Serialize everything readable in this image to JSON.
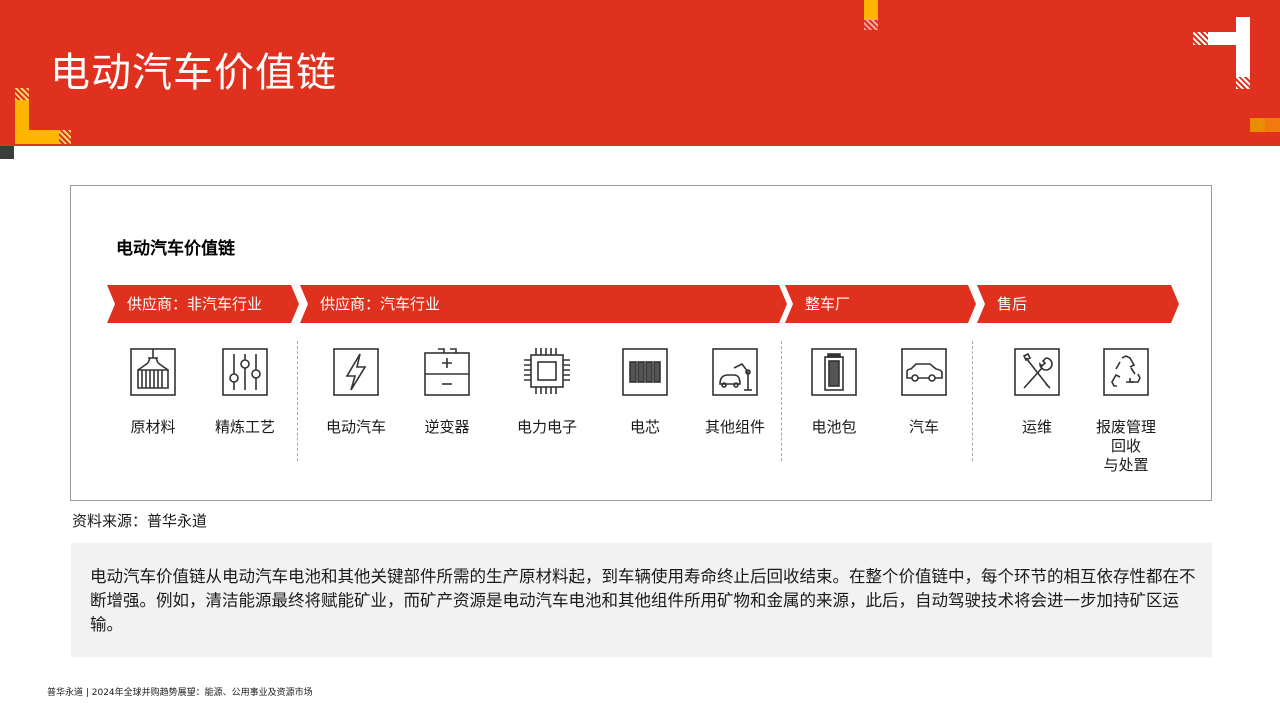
{
  "header": {
    "title": "电动汽车价值链"
  },
  "chart": {
    "title": "电动汽车价值链",
    "stages": [
      {
        "label": "供应商：非汽车行业"
      },
      {
        "label": "供应商：汽车行业"
      },
      {
        "label": "整车厂"
      },
      {
        "label": "售后"
      }
    ],
    "items": [
      {
        "label": "原材料",
        "icon": "raw-material-crane-icon"
      },
      {
        "label": "精炼工艺",
        "icon": "refining-sliders-icon"
      },
      {
        "label": "电动汽车",
        "icon": "lightning-icon"
      },
      {
        "label": "逆变器",
        "icon": "inverter-icon"
      },
      {
        "label": "电力电子",
        "icon": "chip-icon"
      },
      {
        "label": "电芯",
        "icon": "battery-cells-icon"
      },
      {
        "label": "其他组件",
        "icon": "robot-arm-car-icon"
      },
      {
        "label": "电池包",
        "icon": "battery-pack-icon"
      },
      {
        "label": "汽车",
        "icon": "car-icon"
      },
      {
        "label": "运维",
        "icon": "wrench-screwdriver-icon"
      },
      {
        "label_lines": [
          "报废管理",
          "回收",
          "与处置"
        ],
        "icon": "recycle-icon"
      }
    ]
  },
  "source": "资料来源：普华永道",
  "summary": "电动汽车价值链从电动汽车电池和其他关键部件所需的生产原材料起，到车辆使用寿命终止后回收结束。在整个价值链中，每个环节的相互依存性都在不断增强。例如，清洁能源最终将赋能矿业，而矿产资源是电动汽车电池和其他组件所用矿物和金属的来源，此后，自动驾驶技术将会进一步加持矿区运输。",
  "footer": "普华永道 | 2024年全球并购趋势展望：能源、公用事业及资源市场",
  "colors": {
    "brand_red": "#e0301e",
    "accent_orange": "#eb8c00",
    "accent_yellow": "#ffb600",
    "dark_gray": "#3c3c3c",
    "panel_gray": "#f2f2f2"
  }
}
